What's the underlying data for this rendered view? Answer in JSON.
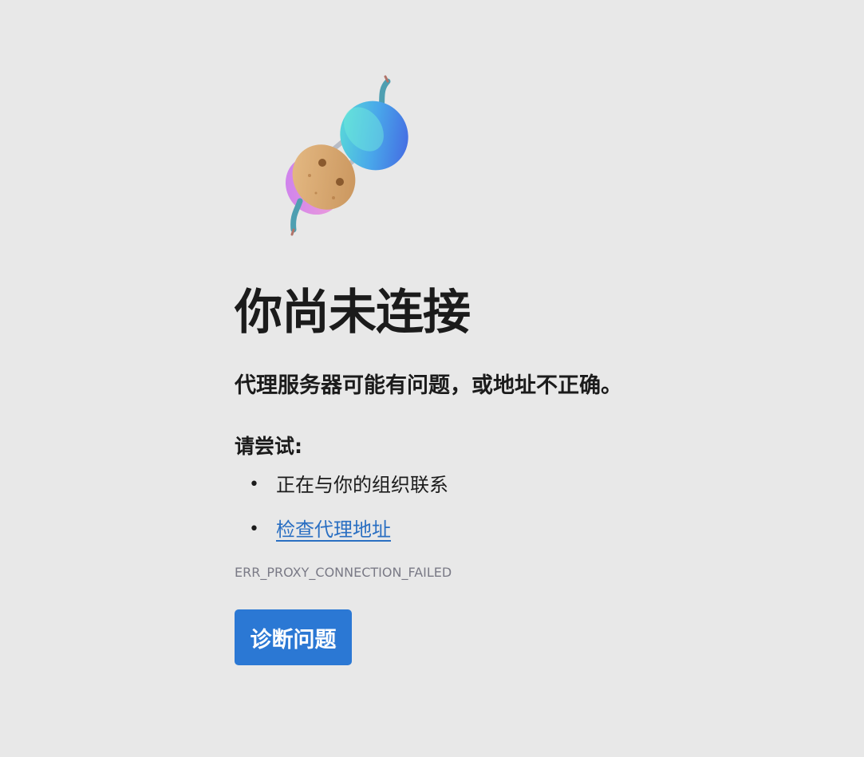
{
  "error_page": {
    "illustration": "unplugged-connector-illustration",
    "title": "你尚未连接",
    "subtitle": "代理服务器可能有问题，或地址不正确。",
    "try_heading": "请尝试:",
    "suggestions": [
      {
        "text": "正在与你的组织联系",
        "is_link": false
      },
      {
        "text": "检查代理地址",
        "is_link": true
      }
    ],
    "bullet": "•",
    "error_code": "ERR_PROXY_CONNECTION_FAILED",
    "diagnose_button": "诊断问题"
  },
  "colors": {
    "background": "#e8e8e8",
    "text": "#1b1b1b",
    "link": "#2a6fc2",
    "error_code": "#7a7a86",
    "button": "#2b78d4"
  }
}
